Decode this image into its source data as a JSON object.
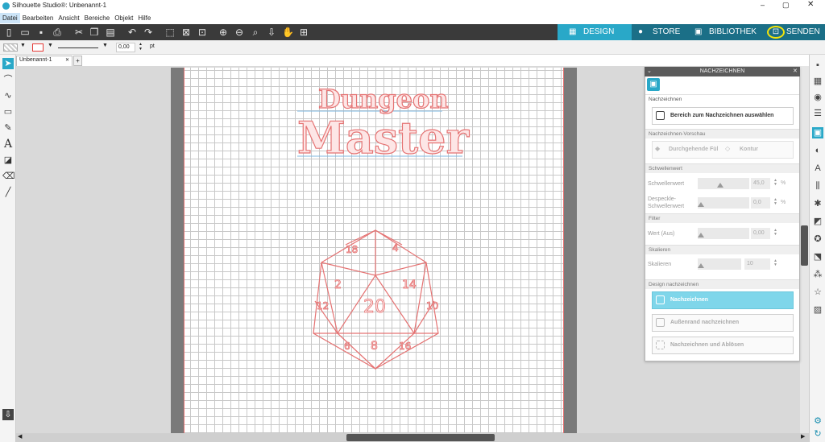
{
  "titlebar": {
    "title": "Silhouette Studio®: Unbenannt-1"
  },
  "menu": [
    "Datei",
    "Bearbeiten",
    "Ansicht",
    "Bereiche",
    "Objekt",
    "Hilfe"
  ],
  "nav": {
    "design": "DESIGN",
    "store": "STORE",
    "library": "BIBLIOTHEK",
    "send": "SENDEN",
    "accent": "#29a8c8"
  },
  "linebar": {
    "width_value": "0,00",
    "unit": "pt"
  },
  "doc": {
    "tab": "Unbenannt-1",
    "add": "+"
  },
  "design": {
    "line1": "Dungeon",
    "line2": "Master",
    "die_center": "20",
    "die_numbers": [
      "18",
      "4",
      "2",
      "14",
      "12",
      "10",
      "6",
      "8",
      "16"
    ]
  },
  "panel": {
    "title": "NACHZEICHNEN",
    "sec_trace": "Nachzeichnen",
    "btn_select_area": "Bereich zum Nachzeichnen auswählen",
    "sec_preview": "Nachzeichnen-Vorschau",
    "preview_fill": "Durchgehende Fül",
    "preview_contour": "Kontur",
    "sec_threshold": "Schwellenwert",
    "threshold_label": "Schwellenwert",
    "threshold_value": "45,0",
    "threshold_unit": "%",
    "despeckle_label": "Despeckle-Schwellenwert",
    "despeckle_value": "0,0",
    "despeckle_unit": "%",
    "sec_filter": "Filter",
    "filter_label": "Wert (Aus)",
    "filter_value": "0,00",
    "sec_scale": "Skalieren",
    "scale_label": "Skalieren",
    "scale_value": "10",
    "sec_design": "Design nachzeichnen",
    "btn_trace": "Nachzeichnen",
    "btn_outer": "Außenrand nachzeichnen",
    "btn_release": "Nachzeichnen und Ablösen",
    "threshold_level": 0.45,
    "despeckle_level": 0,
    "filter_level": 0,
    "scale_level": 0
  }
}
